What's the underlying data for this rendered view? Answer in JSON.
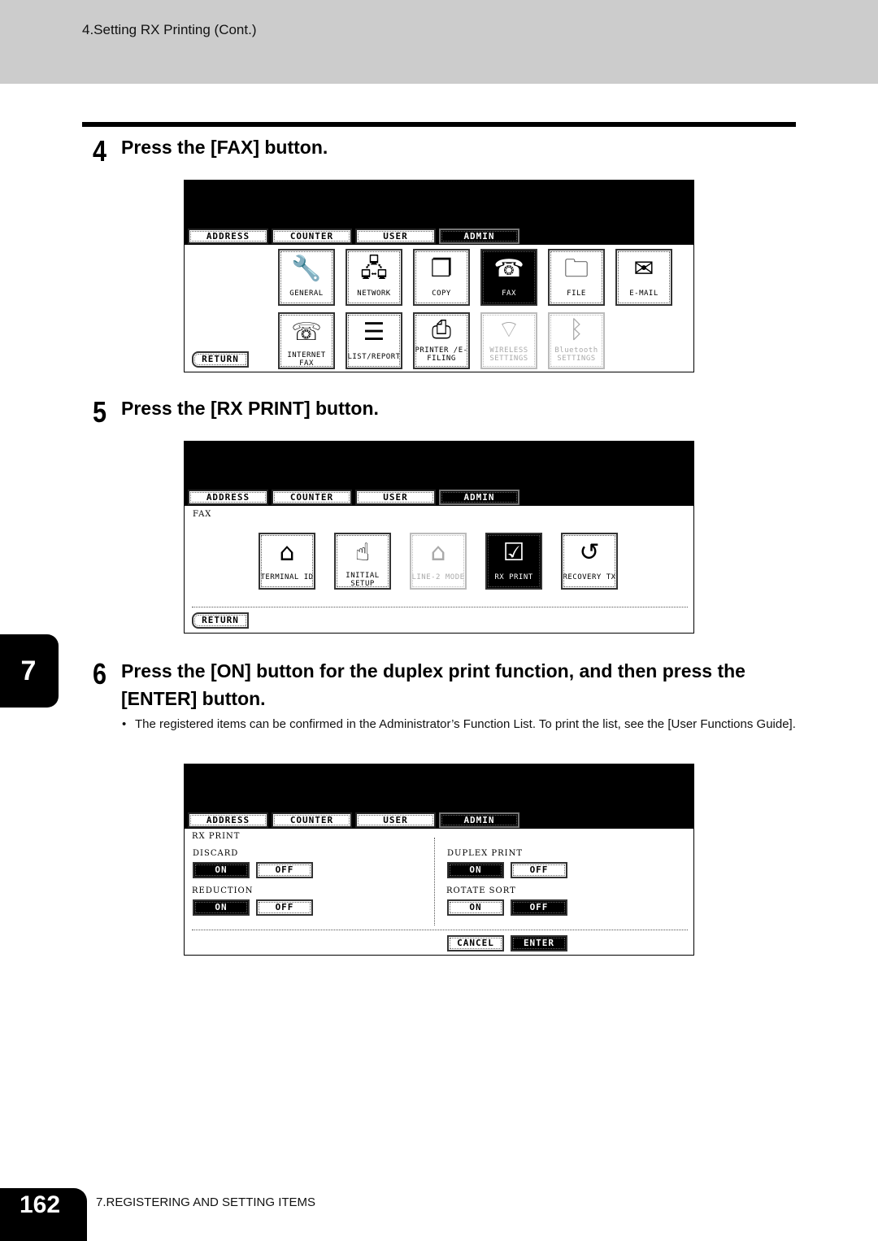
{
  "header": {
    "title": "4.Setting RX Printing (Cont.)"
  },
  "steps": [
    {
      "number": "4",
      "text": "Press the [FAX] button."
    },
    {
      "number": "5",
      "text": "Press the [RX PRINT] button."
    },
    {
      "number": "6",
      "text": "Press the [ON] button for the duplex print function, and then press the [ENTER] button."
    }
  ],
  "note": {
    "bullet": "•",
    "text": "The registered items can be confirmed in the Administrator’s Function List. To print the list, see the [User Functions Guide]."
  },
  "chapter_tab": "7",
  "footer": {
    "page_number": "162",
    "section": "7.REGISTERING AND SETTING ITEMS"
  },
  "tabs": [
    "ADDRESS",
    "COUNTER",
    "USER",
    "ADMIN"
  ],
  "screen1": {
    "row1": [
      {
        "label": "GENERAL",
        "icon": "wrench-copier-icon",
        "glyph": "🔧"
      },
      {
        "label": "NETWORK",
        "icon": "wrench-network-icon",
        "glyph": "🖧"
      },
      {
        "label": "COPY",
        "icon": "wrench-copy-icon",
        "glyph": "❐"
      },
      {
        "label": "FAX",
        "icon": "wrench-fax-icon",
        "glyph": "☎"
      },
      {
        "label": "FILE",
        "icon": "wrench-file-icon",
        "glyph": "🗀"
      },
      {
        "label": "E-MAIL",
        "icon": "wrench-email-icon",
        "glyph": "✉"
      }
    ],
    "row2": [
      {
        "label": "INTERNET FAX",
        "icon": "wrench-internet-fax-icon",
        "glyph": "☏"
      },
      {
        "label": "LIST/REPORT",
        "icon": "list-report-icon",
        "glyph": "☰"
      },
      {
        "label": "PRINTER /E-FILING",
        "icon": "wrench-printer-icon",
        "glyph": "⎙"
      },
      {
        "label": "WIRELESS SETTINGS",
        "icon": "wrench-wireless-icon",
        "glyph": "⌔"
      },
      {
        "label": "Bluetooth SETTINGS",
        "icon": "wrench-bluetooth-icon",
        "glyph": "ᛒ"
      }
    ],
    "return_label": "RETURN"
  },
  "screen2": {
    "section": "FAX",
    "items": [
      {
        "label": "TERMINAL ID",
        "icon": "terminal-id-icon",
        "glyph": "⌂"
      },
      {
        "label": "INITIAL SETUP",
        "icon": "initial-setup-icon",
        "glyph": "☝"
      },
      {
        "label": "LINE-2 MODE",
        "icon": "line-2-mode-icon",
        "glyph": "⌂"
      },
      {
        "label": "RX PRINT",
        "icon": "rx-print-icon",
        "glyph": "☑"
      },
      {
        "label": "RECOVERY TX",
        "icon": "recovery-tx-icon",
        "glyph": "↺"
      }
    ],
    "return_label": "RETURN"
  },
  "screen3": {
    "section": "RX PRINT",
    "settings": [
      {
        "label": "DISCARD",
        "on": "ON",
        "off": "OFF",
        "value": "ON"
      },
      {
        "label": "REDUCTION",
        "on": "ON",
        "off": "OFF",
        "value": "ON"
      },
      {
        "label": "DUPLEX PRINT",
        "on": "ON",
        "off": "OFF",
        "value": "ON"
      },
      {
        "label": "ROTATE SORT",
        "on": "ON",
        "off": "OFF",
        "value": "OFF"
      }
    ],
    "cancel_label": "CANCEL",
    "enter_label": "ENTER"
  }
}
